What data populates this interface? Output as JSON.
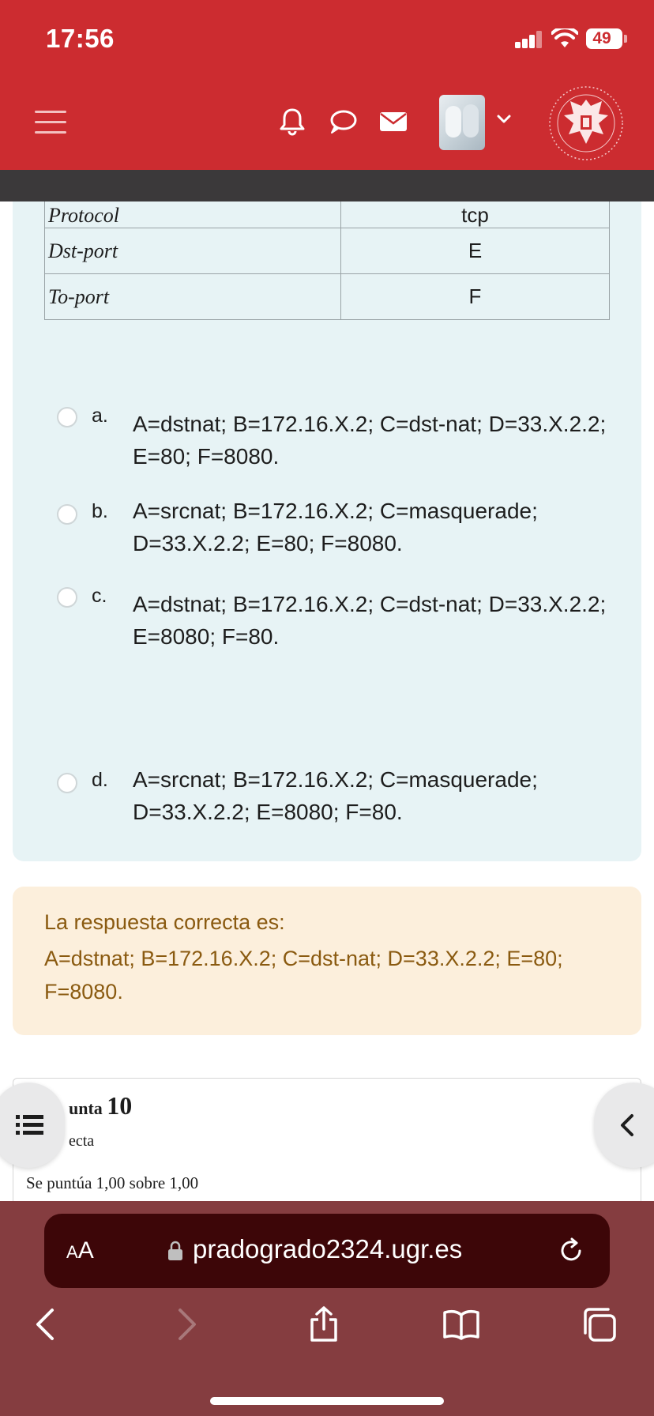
{
  "status": {
    "time": "17:56",
    "battery": "49"
  },
  "header": {
    "icons": [
      "menu-icon",
      "bell-icon",
      "chat-icon",
      "mail-icon",
      "avatar",
      "chevron-down-icon",
      "university-logo"
    ],
    "accent": "#cc2c30"
  },
  "table": {
    "rows": [
      {
        "label": "Protocol",
        "value": "tcp"
      },
      {
        "label": "Dst-port",
        "value": "E"
      },
      {
        "label": "To-port",
        "value": "F"
      }
    ]
  },
  "options": [
    {
      "letter": "a.",
      "text": "A=dstnat; B=172.16.X.2; C=dst-nat; D=33.X.2.2; E=80; F=8080."
    },
    {
      "letter": "b.",
      "text": "A=srcnat; B=172.16.X.2; C=masquerade; D=33.X.2.2; E=80; F=8080."
    },
    {
      "letter": "c.",
      "text": "A=dstnat; B=172.16.X.2; C=dst-nat; D=33.X.2.2; E=8080; F=80."
    },
    {
      "letter": "d.",
      "text": "A=srcnat; B=172.16.X.2; C=masquerade; D=33.X.2.2; E=8080; F=80."
    }
  ],
  "answer": {
    "title": "La respuesta correcta es:",
    "text": "A=dstnat; B=172.16.X.2; C=dst-nat; D=33.X.2.2; E=80; F=8080."
  },
  "next_question": {
    "title_prefix": "unta",
    "number": "10",
    "status": "ecta",
    "score": "Se puntúa 1,00 sobre 1,00"
  },
  "browser": {
    "aa_label": "A",
    "aa_big": "A",
    "url": "pradogrado2324.ugr.es"
  }
}
